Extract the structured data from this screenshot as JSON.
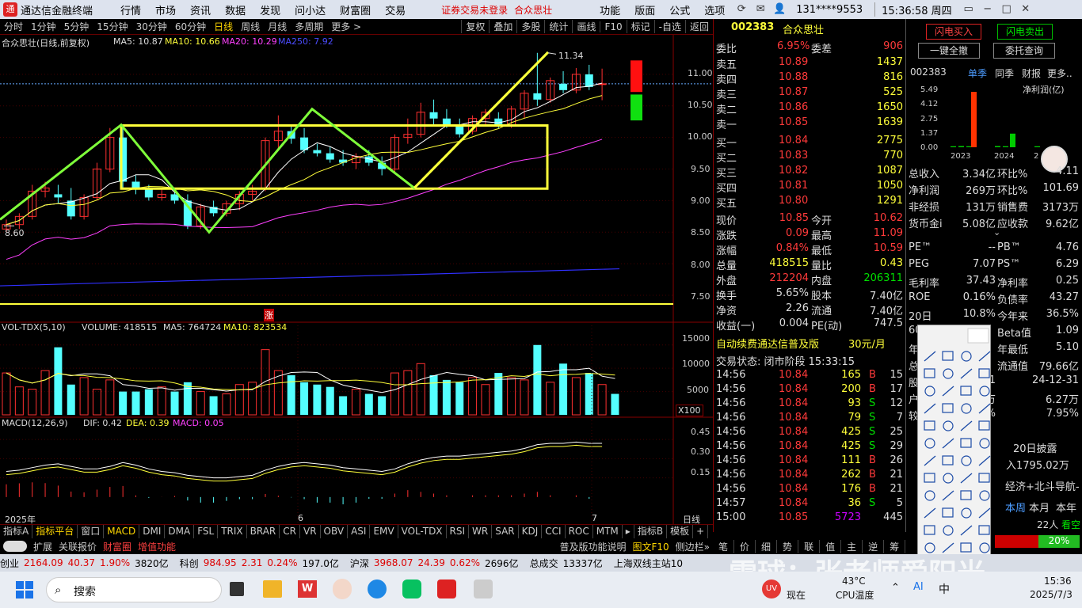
{
  "titlebar": {
    "app": "通达信金融终端",
    "menus": [
      "行情",
      "市场",
      "资讯",
      "数据",
      "发现",
      "问小达",
      "财富圈",
      "交易"
    ],
    "warning": "证券交易未登录",
    "stock_name": "合众思壮",
    "menus_right": [
      "功能",
      "版面",
      "公式",
      "选项"
    ],
    "user": "131****9553",
    "time": "15:36:58 周四"
  },
  "periodbar": {
    "periods": [
      "分时",
      "1分钟",
      "5分钟",
      "15分钟",
      "30分钟",
      "60分钟",
      "日线",
      "周线",
      "月线",
      "多周期",
      "更多 >"
    ],
    "tools": [
      "复权",
      "叠加",
      "多股",
      "统计",
      "画线",
      "F10",
      "标记",
      "-自选",
      "返回"
    ]
  },
  "chart": {
    "title": "合众思壮(日线,前复权)",
    "ma5": "MA5: 10.87",
    "ma10": "MA10: 10.66",
    "ma20": "MA20: 10.29",
    "ma250": "MA250: 7.92",
    "high_label": "11.34",
    "low_label": "8.60",
    "zhang_mark": "涨",
    "price_axis": [
      "11.00",
      "10.50",
      "10.00",
      "9.50",
      "9.00",
      "8.50",
      "8.00",
      "7.50"
    ],
    "vol_title": "VOL-TDX(5,10)",
    "volume": "VOLUME: 418515",
    "vol_ma5": "MA5: 764724",
    "vol_ma10": "MA10: 823534",
    "vol_axis": [
      "15000",
      "10000",
      "5000"
    ],
    "vol_unit": "X100",
    "macd_title": "MACD(12,26,9)",
    "dif": "DIF: 0.42",
    "dea": "DEA: 0.39",
    "macd": "MACD: 0.05",
    "macd_axis": [
      "0.45",
      "0.30",
      "0.15"
    ],
    "date_labels": [
      "2025年",
      "6",
      "7"
    ],
    "period_label": "日线"
  },
  "chart_data": {
    "type": "candlestick",
    "ohlc_approx": [
      {
        "o": 8.55,
        "h": 8.7,
        "l": 8.5,
        "c": 8.62
      },
      {
        "o": 8.62,
        "h": 8.8,
        "l": 8.55,
        "c": 8.75
      },
      {
        "o": 8.75,
        "h": 9.25,
        "l": 8.7,
        "c": 9.15
      },
      {
        "o": 9.15,
        "h": 9.3,
        "l": 9.05,
        "c": 9.2
      },
      {
        "o": 9.1,
        "h": 9.25,
        "l": 8.95,
        "c": 9.05
      },
      {
        "o": 9.0,
        "h": 9.2,
        "l": 8.7,
        "c": 8.75
      },
      {
        "o": 8.75,
        "h": 9.1,
        "l": 8.7,
        "c": 9.05
      },
      {
        "o": 9.05,
        "h": 9.6,
        "l": 9.0,
        "c": 9.5
      },
      {
        "o": 9.5,
        "h": 10.15,
        "l": 9.45,
        "c": 10.0
      },
      {
        "o": 10.0,
        "h": 10.15,
        "l": 9.2,
        "c": 9.3
      },
      {
        "o": 9.3,
        "h": 9.4,
        "l": 9.1,
        "c": 9.2
      },
      {
        "o": 9.2,
        "h": 9.25,
        "l": 9.0,
        "c": 9.05
      },
      {
        "o": 9.05,
        "h": 9.2,
        "l": 9.0,
        "c": 9.1
      },
      {
        "o": 9.1,
        "h": 9.15,
        "l": 8.95,
        "c": 9.0
      },
      {
        "o": 9.0,
        "h": 9.1,
        "l": 8.55,
        "c": 8.6
      },
      {
        "o": 8.6,
        "h": 8.95,
        "l": 8.55,
        "c": 8.9
      },
      {
        "o": 8.9,
        "h": 9.0,
        "l": 8.75,
        "c": 8.8
      },
      {
        "o": 8.8,
        "h": 9.0,
        "l": 8.75,
        "c": 8.95
      },
      {
        "o": 8.95,
        "h": 9.15,
        "l": 8.85,
        "c": 9.1
      },
      {
        "o": 9.1,
        "h": 9.25,
        "l": 9.0,
        "c": 9.15
      },
      {
        "o": 9.2,
        "h": 10.0,
        "l": 9.15,
        "c": 9.95
      },
      {
        "o": 9.95,
        "h": 10.35,
        "l": 9.8,
        "c": 10.1
      },
      {
        "o": 10.1,
        "h": 10.2,
        "l": 9.9,
        "c": 9.98
      },
      {
        "o": 10.0,
        "h": 10.15,
        "l": 9.75,
        "c": 9.8
      },
      {
        "o": 9.8,
        "h": 9.9,
        "l": 9.7,
        "c": 9.75
      },
      {
        "o": 9.75,
        "h": 9.85,
        "l": 9.6,
        "c": 9.65
      },
      {
        "o": 9.65,
        "h": 9.8,
        "l": 9.55,
        "c": 9.6
      },
      {
        "o": 9.6,
        "h": 9.75,
        "l": 9.5,
        "c": 9.7
      },
      {
        "o": 9.7,
        "h": 9.8,
        "l": 9.55,
        "c": 9.6
      },
      {
        "o": 9.6,
        "h": 9.7,
        "l": 9.4,
        "c": 9.5
      },
      {
        "o": 9.5,
        "h": 10.05,
        "l": 9.45,
        "c": 10.0
      },
      {
        "o": 10.0,
        "h": 10.3,
        "l": 9.9,
        "c": 10.05
      },
      {
        "o": 10.05,
        "h": 10.55,
        "l": 10.0,
        "c": 10.4
      },
      {
        "o": 10.4,
        "h": 10.6,
        "l": 10.2,
        "c": 10.3
      },
      {
        "o": 10.3,
        "h": 10.45,
        "l": 10.15,
        "c": 10.2
      },
      {
        "o": 10.2,
        "h": 10.3,
        "l": 10.0,
        "c": 10.05
      },
      {
        "o": 10.1,
        "h": 10.35,
        "l": 10.05,
        "c": 10.3
      },
      {
        "o": 10.3,
        "h": 10.45,
        "l": 10.2,
        "c": 10.4
      },
      {
        "o": 10.3,
        "h": 10.4,
        "l": 10.15,
        "c": 10.2
      },
      {
        "o": 10.2,
        "h": 10.5,
        "l": 10.15,
        "c": 10.45
      },
      {
        "o": 10.45,
        "h": 10.75,
        "l": 10.3,
        "c": 10.7
      },
      {
        "o": 10.7,
        "h": 11.34,
        "l": 10.5,
        "c": 10.6
      },
      {
        "o": 10.6,
        "h": 10.95,
        "l": 10.55,
        "c": 10.9
      },
      {
        "o": 10.85,
        "h": 11.05,
        "l": 10.7,
        "c": 10.75
      },
      {
        "o": 10.75,
        "h": 11.1,
        "l": 10.7,
        "c": 11.0
      },
      {
        "o": 11.0,
        "h": 11.15,
        "l": 10.75,
        "c": 10.8
      },
      {
        "o": 10.84,
        "h": 11.09,
        "l": 10.59,
        "c": 10.85
      }
    ],
    "volume_x100_approx": [
      9000,
      6000,
      5500,
      9500,
      14500,
      6500,
      8000,
      5500,
      7500,
      5000,
      5000,
      5500,
      6000,
      5000,
      7000,
      5000,
      4000,
      4500,
      6500,
      7000,
      14000,
      9500,
      8500,
      7000,
      6500,
      6000,
      4000,
      5500,
      4500,
      4000,
      9000,
      9500,
      11000,
      8500,
      7500,
      7000,
      8000,
      6500,
      9000,
      8000,
      7500,
      15000,
      7000,
      11000,
      8000,
      9000,
      6500,
      4500
    ],
    "macd_approx": [
      0.2,
      0.21,
      0.23,
      0.25,
      0.26,
      0.24,
      0.22,
      0.22,
      0.24,
      0.27,
      0.25,
      0.22,
      0.2,
      0.19,
      0.17,
      0.16,
      0.15,
      0.15,
      0.16,
      0.17,
      0.21,
      0.24,
      0.26,
      0.27,
      0.26,
      0.25,
      0.23,
      0.22,
      0.21,
      0.2,
      0.22,
      0.26,
      0.29,
      0.31,
      0.32,
      0.32,
      0.33,
      0.34,
      0.35,
      0.36,
      0.38,
      0.41,
      0.42,
      0.42,
      0.43,
      0.42,
      0.42
    ],
    "ylim": [
      7.3,
      11.5
    ],
    "last_close": 10.85
  },
  "orderbook": {
    "code": "002383",
    "name": "合众思壮",
    "weibi_label": "委比",
    "weibi": "6.95%",
    "weicha_label": "委差",
    "weicha": "906",
    "asks": [
      {
        "label": "卖五",
        "price": "10.89",
        "vol": "1437"
      },
      {
        "label": "卖四",
        "price": "10.88",
        "vol": "816"
      },
      {
        "label": "卖三",
        "price": "10.87",
        "vol": "525"
      },
      {
        "label": "卖二",
        "price": "10.86",
        "vol": "1650"
      },
      {
        "label": "卖一",
        "price": "10.85",
        "vol": "1639"
      }
    ],
    "bids": [
      {
        "label": "买一",
        "price": "10.84",
        "vol": "2775"
      },
      {
        "label": "买二",
        "price": "10.83",
        "vol": "770"
      },
      {
        "label": "买三",
        "price": "10.82",
        "vol": "1087"
      },
      {
        "label": "买四",
        "price": "10.81",
        "vol": "1050"
      },
      {
        "label": "买五",
        "price": "10.80",
        "vol": "1291"
      }
    ],
    "stats": [
      [
        "现价",
        "10.85",
        "今开",
        "10.62"
      ],
      [
        "涨跌",
        "0.09",
        "最高",
        "11.09"
      ],
      [
        "涨幅",
        "0.84%",
        "最低",
        "10.59"
      ],
      [
        "总量",
        "418515",
        "量比",
        "0.43"
      ],
      [
        "外盘",
        "212204",
        "内盘",
        "206311"
      ],
      [
        "换手",
        "5.65%",
        "股本",
        "7.40亿"
      ],
      [
        "净资",
        "2.26",
        "流通",
        "7.40亿"
      ],
      [
        "收益(一)",
        "0.004",
        "PE(动)",
        "747.5"
      ]
    ],
    "promo": "自动续费通达信普及版",
    "promo_price": "30元/月",
    "trade_status": "交易状态: 闭市阶段 15:33:15",
    "ticks": [
      [
        "14:56",
        "10.84",
        "165",
        "B",
        "15"
      ],
      [
        "14:56",
        "10.84",
        "200",
        "B",
        "17"
      ],
      [
        "14:56",
        "10.84",
        "93",
        "S",
        "12"
      ],
      [
        "14:56",
        "10.84",
        "79",
        "S",
        "7"
      ],
      [
        "14:56",
        "10.84",
        "425",
        "S",
        "25"
      ],
      [
        "14:56",
        "10.84",
        "425",
        "S",
        "29"
      ],
      [
        "14:56",
        "10.84",
        "111",
        "B",
        "26"
      ],
      [
        "14:56",
        "10.84",
        "262",
        "B",
        "21"
      ],
      [
        "14:56",
        "10.84",
        "176",
        "B",
        "21"
      ],
      [
        "14:57",
        "10.84",
        "36",
        "S",
        "5"
      ],
      [
        "15:00",
        "10.85",
        "5723",
        "",
        "445"
      ]
    ]
  },
  "fin": {
    "buy_btn": "闪电买入",
    "sell_btn": "闪电卖出",
    "cancel_btn": "一键全撤",
    "query_btn": "委托查询",
    "code": "002383",
    "tabs": [
      "单季",
      "同季",
      "财报",
      "更多.."
    ],
    "metric": "净利润(亿)",
    "y_ticks": [
      "5.49",
      "4.12",
      "2.75",
      "1.37",
      "0.00"
    ],
    "years": [
      "2023",
      "2024",
      "2"
    ],
    "rows": [
      [
        "总收入",
        "3.34亿",
        "环比%",
        "-4.11"
      ],
      [
        "净利润",
        "269万",
        "环比%",
        "101.69"
      ],
      [
        "非经损",
        "131万",
        "销售费",
        "3173万"
      ],
      [
        "货币金i",
        "5.08亿",
        "应收款",
        "9.62亿"
      ]
    ],
    "rows2": [
      [
        "PE™",
        "--",
        "PB™",
        "4.76"
      ],
      [
        "PEG",
        "7.07",
        "PS™",
        "6.29"
      ],
      [
        "毛利率",
        "37.43",
        "净利率",
        "0.25"
      ],
      [
        "ROE",
        "0.16%",
        "负债率",
        "43.27"
      ],
      [
        "20日",
        "10.8%",
        "今年来",
        "36.5%"
      ],
      [
        "60",
        "",
        "Beta值",
        "1.09"
      ],
      [
        "年",
        "",
        "年最低",
        "5.10"
      ],
      [
        "总",
        "",
        "流通值",
        "79.66亿"
      ],
      [
        "股",
        "3-31",
        "",
        "24-12-31"
      ],
      [
        "户",
        "16万",
        "",
        "6.27万"
      ],
      [
        "较",
        "81%",
        "",
        "7.95%"
      ]
    ],
    "disclose": "20日披露",
    "income": "入1795.02万",
    "nav": "经济+北斗导航-",
    "period_tabs": [
      "本周",
      "本月",
      "本年"
    ],
    "people": "22人",
    "people2": "看空",
    "pct": "20%"
  },
  "bottomtabs": [
    "指标A",
    "指标平台",
    "窗口",
    "MACD",
    "DMI",
    "DMA",
    "FSL",
    "TRIX",
    "BRAR",
    "CR",
    "VR",
    "OBV",
    "ASI",
    "EMV",
    "VOL-TDX",
    "RSI",
    "WR",
    "SAR",
    "KDJ",
    "CCI",
    "ROC",
    "MTM",
    "▸",
    "指标B",
    "模板",
    "+"
  ],
  "exttabs": [
    "扩展",
    "关联报价",
    "财富圈",
    "增值功能"
  ],
  "ext_right": [
    "普及版功能说明",
    "图文F10",
    "侧边栏»"
  ],
  "rtabs": [
    "笔",
    "价",
    "细",
    "势",
    "联",
    "值",
    "主",
    "逆",
    "筹"
  ],
  "statusbar": [
    [
      "创业",
      "2164.09",
      "40.37",
      "1.90%",
      "3820亿"
    ],
    [
      "科创",
      "984.95",
      "2.31",
      "0.24%",
      "197.0亿"
    ],
    [
      "沪深",
      "3968.07",
      "24.39",
      "0.62%",
      "2696亿"
    ],
    [
      "总成交",
      "13337亿"
    ],
    [
      "上海双线主站10"
    ]
  ],
  "watermark": "雪球：张老师爱阳光",
  "taskbar": {
    "search": "搜索",
    "weather_temp": "43°C",
    "cpu": "CPU温度",
    "now": "现在",
    "ime": "中",
    "clock": "15:36",
    "date": "2025/7/3"
  }
}
